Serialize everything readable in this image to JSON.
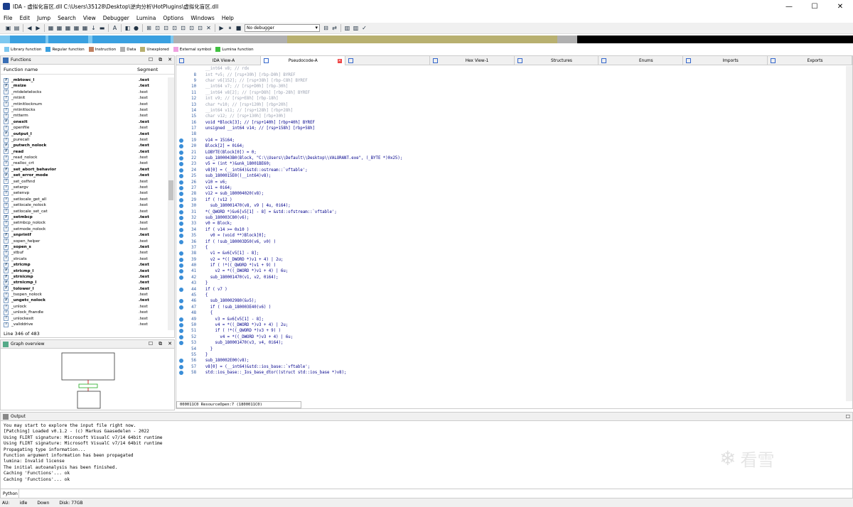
{
  "window": {
    "title": "IDA - 虚拟化盲区.dll C:\\Users\\35128\\Desktop\\逆向分析\\HotPlugins\\虚拟化盲区.dll",
    "minimize": "—",
    "maximize": "☐",
    "close": "✕"
  },
  "menu": [
    "File",
    "Edit",
    "Jump",
    "Search",
    "View",
    "Debugger",
    "Lumina",
    "Options",
    "Windows",
    "Help"
  ],
  "toolbar": {
    "debugger_select": "No debugger"
  },
  "legend": [
    {
      "label": "Library function",
      "color": "#7ec8f0"
    },
    {
      "label": "Regular function",
      "color": "#3aa0e0"
    },
    {
      "label": "Instruction",
      "color": "#c08060"
    },
    {
      "label": "Data",
      "color": "#b0b0b0"
    },
    {
      "label": "Unexplored",
      "color": "#b8b070"
    },
    {
      "label": "External symbol",
      "color": "#f0a0e0"
    },
    {
      "label": "Lumina function",
      "color": "#40c040"
    }
  ],
  "functions_panel": {
    "title": "Functions",
    "col_name": "Function name",
    "col_segment": "Segment",
    "status": "Line 346 of 483",
    "rows": [
      {
        "name": "_mbtowc_l",
        "seg": ".text",
        "bold": true
      },
      {
        "name": "_msize",
        "seg": ".text",
        "bold": true
      },
      {
        "name": "_mtdeletelocks",
        "seg": ".text",
        "bold": false
      },
      {
        "name": "_mtinit",
        "seg": ".text",
        "bold": false
      },
      {
        "name": "_mtinitlocknum",
        "seg": ".text",
        "bold": false
      },
      {
        "name": "_mtinitlocks",
        "seg": ".text",
        "bold": false
      },
      {
        "name": "_mtterm",
        "seg": ".text",
        "bold": false
      },
      {
        "name": "_onexit",
        "seg": ".text",
        "bold": true
      },
      {
        "name": "_openfile",
        "seg": ".text",
        "bold": false
      },
      {
        "name": "_output_l",
        "seg": ".text",
        "bold": true
      },
      {
        "name": "_purecall",
        "seg": ".text",
        "bold": false
      },
      {
        "name": "_putwch_nolock",
        "seg": ".text",
        "bold": true
      },
      {
        "name": "_read",
        "seg": ".text",
        "bold": true
      },
      {
        "name": "_read_nolock",
        "seg": ".text",
        "bold": false
      },
      {
        "name": "_realloc_crt",
        "seg": ".text",
        "bold": false
      },
      {
        "name": "_set_abort_behavior",
        "seg": ".text",
        "bold": true
      },
      {
        "name": "_set_error_mode",
        "seg": ".text",
        "bold": true
      },
      {
        "name": "_set_osfhnd",
        "seg": ".text",
        "bold": false
      },
      {
        "name": "_setargv",
        "seg": ".text",
        "bold": false
      },
      {
        "name": "_setenvp",
        "seg": ".text",
        "bold": false
      },
      {
        "name": "_setlocale_get_all",
        "seg": ".text",
        "bold": false
      },
      {
        "name": "_setlocale_nolock",
        "seg": ".text",
        "bold": false
      },
      {
        "name": "_setlocale_set_cat",
        "seg": ".text",
        "bold": false
      },
      {
        "name": "_setmbcp",
        "seg": ".text",
        "bold": true
      },
      {
        "name": "_setmbcp_nolock",
        "seg": ".text",
        "bold": false
      },
      {
        "name": "_setmode_nolock",
        "seg": ".text",
        "bold": false
      },
      {
        "name": "_snprintf",
        "seg": ".text",
        "bold": true
      },
      {
        "name": "_sopen_helper",
        "seg": ".text",
        "bold": false
      },
      {
        "name": "_sopen_s",
        "seg": ".text",
        "bold": true
      },
      {
        "name": "_stbuf",
        "seg": ".text",
        "bold": false
      },
      {
        "name": "_strcats",
        "seg": ".text",
        "bold": false
      },
      {
        "name": "_stricmp",
        "seg": ".text",
        "bold": true
      },
      {
        "name": "_stricmp_l",
        "seg": ".text",
        "bold": true
      },
      {
        "name": "_strnicmp",
        "seg": ".text",
        "bold": true
      },
      {
        "name": "_strnicmp_l",
        "seg": ".text",
        "bold": true
      },
      {
        "name": "_tolower_l",
        "seg": ".text",
        "bold": true
      },
      {
        "name": "_tsopen_nolock",
        "seg": ".text",
        "bold": false
      },
      {
        "name": "_ungetc_nolock",
        "seg": ".text",
        "bold": true
      },
      {
        "name": "_unlock",
        "seg": ".text",
        "bold": false
      },
      {
        "name": "_unlock_fhandle",
        "seg": ".text",
        "bold": false
      },
      {
        "name": "_unlockexit",
        "seg": ".text",
        "bold": false
      },
      {
        "name": "_validdrive",
        "seg": ".text",
        "bold": false
      }
    ]
  },
  "graph_panel": {
    "title": "Graph overview"
  },
  "tabs": [
    {
      "label": "IDA View-A",
      "close": false
    },
    {
      "label": "Pseudocode-A",
      "close": true
    },
    {
      "label": "",
      "close": false
    },
    {
      "label": "Hex View-1",
      "close": false
    },
    {
      "label": "Structures",
      "close": false
    },
    {
      "label": "Enums",
      "close": false
    },
    {
      "label": "Imports",
      "close": false
    },
    {
      "label": "Exports",
      "close": false
    }
  ],
  "code_lines": [
    {
      "n": "",
      "t": "  __int64 v8; // rdx",
      "dot": false,
      "cm": true
    },
    {
      "n": "8",
      "t": "  int *v5; // [rsp+30h] [rbp-D0h] BYREF",
      "dot": false,
      "cm": true
    },
    {
      "n": "9",
      "t": "  char v6[152]; // [rsp+38h] [rbp-C8h] BYREF",
      "dot": false,
      "cm": true
    },
    {
      "n": "10",
      "t": "  __int64 v7; // [rsp+D0h] [rbp-30h]",
      "dot": false,
      "cm": true
    },
    {
      "n": "11",
      "t": "  __int64 v8[2]; // [rsp+D8h] [rbp-28h] BYREF",
      "dot": false,
      "cm": true
    },
    {
      "n": "12",
      "t": "  int v9; // [rsp+E8h] [rbp-18h]",
      "dot": false,
      "cm": true
    },
    {
      "n": "13",
      "t": "  char *v10; // [rsp+120h] [rbp+20h]",
      "dot": false,
      "cm": true
    },
    {
      "n": "14",
      "t": "  __int64 v11; // [rsp+128h] [rbp+28h]",
      "dot": false,
      "cm": true
    },
    {
      "n": "15",
      "t": "  char v12; // [rsp+130h] [rbp+30h]",
      "dot": false,
      "cm": true
    },
    {
      "n": "16",
      "t": "  void *Block[3]; // [rsp+140h] [rbp+40h] BYREF",
      "dot": false,
      "cm": false
    },
    {
      "n": "17",
      "t": "  unsigned __int64 v14; // [rsp+158h] [rbp+58h]",
      "dot": false,
      "cm": false
    },
    {
      "n": "18",
      "t": "",
      "dot": false,
      "cm": false
    },
    {
      "n": "19",
      "t": "  v14 = 15i64;",
      "dot": true,
      "cm": false
    },
    {
      "n": "20",
      "t": "  Block[2] = 0i64;",
      "dot": true,
      "cm": false
    },
    {
      "n": "21",
      "t": "  LOBYTE(Block[0]) = 0;",
      "dot": true,
      "cm": false
    },
    {
      "n": "22",
      "t": "  sub_1800043B0(Block, \"C:\\\\Users\\\\Default\\\\Desktop\\\\VALORANT.exe\", (_BYTE *)0x25);",
      "dot": true,
      "cm": false
    },
    {
      "n": "23",
      "t": "  v5 = (int *)&unk_18001BE60;",
      "dot": true,
      "cm": false
    },
    {
      "n": "24",
      "t": "  v8[0] = (__int64)&std::ostream::`vftable';",
      "dot": true,
      "cm": false
    },
    {
      "n": "25",
      "t": "  sub_1800015E0((__int64)v8);",
      "dot": true,
      "cm": false
    },
    {
      "n": "26",
      "t": "  v10 = v6;",
      "dot": true,
      "cm": false
    },
    {
      "n": "27",
      "t": "  v11 = 0i64;",
      "dot": true,
      "cm": false
    },
    {
      "n": "28",
      "t": "  v12 = sub_180004020(v8);",
      "dot": true,
      "cm": false
    },
    {
      "n": "29",
      "t": "  if ( !v12 )",
      "dot": true,
      "cm": false
    },
    {
      "n": "30",
      "t": "    sub_180001470(v8, v9 | 4u, 0i64);",
      "dot": true,
      "cm": false
    },
    {
      "n": "31",
      "t": "  *(_QWORD *)&v6[v5[1] - 8] = &std::ofstream::`vftable';",
      "dot": true,
      "cm": false
    },
    {
      "n": "32",
      "t": "  sub_180003C80(v6);",
      "dot": true,
      "cm": false
    },
    {
      "n": "33",
      "t": "  v0 = Block;",
      "dot": true,
      "cm": false
    },
    {
      "n": "34",
      "t": "  if ( v14 >= 0x10 )",
      "dot": true,
      "cm": false
    },
    {
      "n": "35",
      "t": "    v0 = (void **)Block[0];",
      "dot": true,
      "cm": false
    },
    {
      "n": "36",
      "t": "  if ( !sub_180003D50(v6, v0) )",
      "dot": true,
      "cm": false
    },
    {
      "n": "37",
      "t": "  {",
      "dot": false,
      "cm": false
    },
    {
      "n": "38",
      "t": "    v1 = &v6[v5[1] - 8];",
      "dot": true,
      "cm": false
    },
    {
      "n": "39",
      "t": "    v2 = *((_DWORD *)v1 + 4) | 2u;",
      "dot": true,
      "cm": false
    },
    {
      "n": "40",
      "t": "    if ( !*((_QWORD *)v1 + 9) )",
      "dot": true,
      "cm": false
    },
    {
      "n": "41",
      "t": "      v2 = *((_DWORD *)v1 + 4) | 6u;",
      "dot": true,
      "cm": false
    },
    {
      "n": "42",
      "t": "    sub_180001470(v1, v2, 0i64);",
      "dot": true,
      "cm": false
    },
    {
      "n": "43",
      "t": "  }",
      "dot": false,
      "cm": false
    },
    {
      "n": "44",
      "t": "  if ( v7 )",
      "dot": true,
      "cm": false
    },
    {
      "n": "45",
      "t": "  {",
      "dot": false,
      "cm": false
    },
    {
      "n": "46",
      "t": "    sub_180002980(&v5);",
      "dot": true,
      "cm": false
    },
    {
      "n": "47",
      "t": "    if ( !sub_180003E40(v6) )",
      "dot": true,
      "cm": false
    },
    {
      "n": "48",
      "t": "    {",
      "dot": false,
      "cm": false
    },
    {
      "n": "49",
      "t": "      v3 = &v6[v5[1] - 8];",
      "dot": true,
      "cm": false
    },
    {
      "n": "50",
      "t": "      v4 = *((_DWORD *)v3 + 4) | 2u;",
      "dot": true,
      "cm": false
    },
    {
      "n": "51",
      "t": "      if ( !*((_QWORD *)v3 + 9) )",
      "dot": true,
      "cm": false
    },
    {
      "n": "52",
      "t": "        v4 = *((_DWORD *)v3 + 4) | 6u;",
      "dot": true,
      "cm": false
    },
    {
      "n": "53",
      "t": "      sub_180001470(v3, v4, 0i64);",
      "dot": true,
      "cm": false
    },
    {
      "n": "54",
      "t": "    }",
      "dot": false,
      "cm": false
    },
    {
      "n": "55",
      "t": "  }",
      "dot": false,
      "cm": false
    },
    {
      "n": "56",
      "t": "  sub_180002E00(v8);",
      "dot": true,
      "cm": false
    },
    {
      "n": "57",
      "t": "  v8[0] = (__int64)&std::ios_base::`vftable';",
      "dot": true,
      "cm": false
    },
    {
      "n": "58",
      "t": "  std::ios_base::_Ios_base_dtor((struct std::ios_base *)v8);",
      "dot": true,
      "cm": false
    }
  ],
  "code_status": "000011C0 ResourceOpen:7 (1800011C0)",
  "output_panel": {
    "title": "Output",
    "lines": [
      "You may start to explore the input file right now.",
      "[Patching] Loaded v0.1.2 - (c) Markus Gaasedelen - 2022",
      "Using FLIRT signature: Microsoft VisualC v7/14 64bit runtime",
      "Using FLIRT signature: Microsoft VisualC v7/14 64bit runtime",
      "Propagating type information...",
      "Function argument information has been propagated",
      "lumina: Invalid license",
      "The initial autoanalysis has been finished.",
      "Caching 'Functions'... ok",
      "Caching 'Functions'... ok"
    ],
    "lang": "Python"
  },
  "statusbar": {
    "au": "AU:",
    "state": "idle",
    "dir": "Down",
    "disk": "Disk: 77GB"
  },
  "watermark": {
    "text": "看雪"
  }
}
